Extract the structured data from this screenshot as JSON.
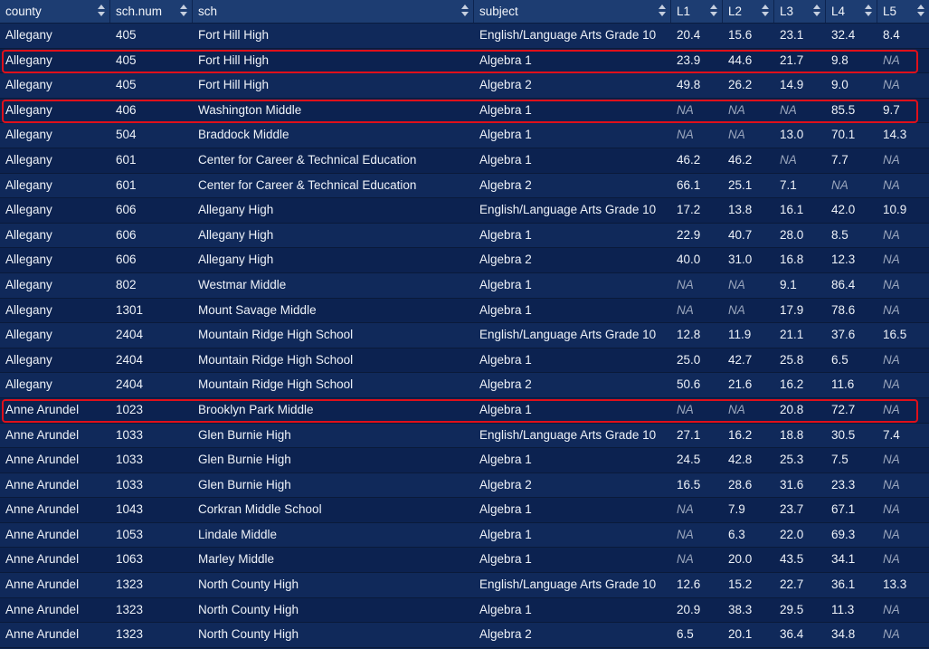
{
  "columns": [
    "county",
    "sch.num",
    "sch",
    "subject",
    "L1",
    "L2",
    "L3",
    "L4",
    "L5"
  ],
  "rows": [
    [
      "Allegany",
      "405",
      "Fort Hill High",
      "English/Language Arts Grade 10",
      "20.4",
      "15.6",
      "23.1",
      "32.4",
      "8.4"
    ],
    [
      "Allegany",
      "405",
      "Fort Hill High",
      "Algebra 1",
      "23.9",
      "44.6",
      "21.7",
      "9.8",
      "NA"
    ],
    [
      "Allegany",
      "405",
      "Fort Hill High",
      "Algebra 2",
      "49.8",
      "26.2",
      "14.9",
      "9.0",
      "NA"
    ],
    [
      "Allegany",
      "406",
      "Washington Middle",
      "Algebra 1",
      "NA",
      "NA",
      "NA",
      "85.5",
      "9.7"
    ],
    [
      "Allegany",
      "504",
      "Braddock Middle",
      "Algebra 1",
      "NA",
      "NA",
      "13.0",
      "70.1",
      "14.3"
    ],
    [
      "Allegany",
      "601",
      "Center for Career & Technical Education",
      "Algebra 1",
      "46.2",
      "46.2",
      "NA",
      "7.7",
      "NA"
    ],
    [
      "Allegany",
      "601",
      "Center for Career & Technical Education",
      "Algebra 2",
      "66.1",
      "25.1",
      "7.1",
      "NA",
      "NA"
    ],
    [
      "Allegany",
      "606",
      "Allegany High",
      "English/Language Arts Grade 10",
      "17.2",
      "13.8",
      "16.1",
      "42.0",
      "10.9"
    ],
    [
      "Allegany",
      "606",
      "Allegany High",
      "Algebra 1",
      "22.9",
      "40.7",
      "28.0",
      "8.5",
      "NA"
    ],
    [
      "Allegany",
      "606",
      "Allegany High",
      "Algebra 2",
      "40.0",
      "31.0",
      "16.8",
      "12.3",
      "NA"
    ],
    [
      "Allegany",
      "802",
      "Westmar Middle",
      "Algebra 1",
      "NA",
      "NA",
      "9.1",
      "86.4",
      "NA"
    ],
    [
      "Allegany",
      "1301",
      "Mount Savage Middle",
      "Algebra 1",
      "NA",
      "NA",
      "17.9",
      "78.6",
      "NA"
    ],
    [
      "Allegany",
      "2404",
      "Mountain Ridge High School",
      "English/Language Arts Grade 10",
      "12.8",
      "11.9",
      "21.1",
      "37.6",
      "16.5"
    ],
    [
      "Allegany",
      "2404",
      "Mountain Ridge High School",
      "Algebra 1",
      "25.0",
      "42.7",
      "25.8",
      "6.5",
      "NA"
    ],
    [
      "Allegany",
      "2404",
      "Mountain Ridge High School",
      "Algebra 2",
      "50.6",
      "21.6",
      "16.2",
      "11.6",
      "NA"
    ],
    [
      "Anne Arundel",
      "1023",
      "Brooklyn Park Middle",
      "Algebra 1",
      "NA",
      "NA",
      "20.8",
      "72.7",
      "NA"
    ],
    [
      "Anne Arundel",
      "1033",
      "Glen Burnie High",
      "English/Language Arts Grade 10",
      "27.1",
      "16.2",
      "18.8",
      "30.5",
      "7.4"
    ],
    [
      "Anne Arundel",
      "1033",
      "Glen Burnie High",
      "Algebra 1",
      "24.5",
      "42.8",
      "25.3",
      "7.5",
      "NA"
    ],
    [
      "Anne Arundel",
      "1033",
      "Glen Burnie High",
      "Algebra 2",
      "16.5",
      "28.6",
      "31.6",
      "23.3",
      "NA"
    ],
    [
      "Anne Arundel",
      "1043",
      "Corkran Middle School",
      "Algebra 1",
      "NA",
      "7.9",
      "23.7",
      "67.1",
      "NA"
    ],
    [
      "Anne Arundel",
      "1053",
      "Lindale Middle",
      "Algebra 1",
      "NA",
      "6.3",
      "22.0",
      "69.3",
      "NA"
    ],
    [
      "Anne Arundel",
      "1063",
      "Marley Middle",
      "Algebra 1",
      "NA",
      "20.0",
      "43.5",
      "34.1",
      "NA"
    ],
    [
      "Anne Arundel",
      "1323",
      "North County High",
      "English/Language Arts Grade 10",
      "12.6",
      "15.2",
      "22.7",
      "36.1",
      "13.3"
    ],
    [
      "Anne Arundel",
      "1323",
      "North County High",
      "Algebra 1",
      "20.9",
      "38.3",
      "29.5",
      "11.3",
      "NA"
    ],
    [
      "Anne Arundel",
      "1323",
      "North County High",
      "Algebra 2",
      "6.5",
      "20.1",
      "36.4",
      "34.8",
      "NA"
    ]
  ],
  "highlighted_rows": [
    1,
    3,
    15
  ],
  "colors": {
    "header_bg": "#1d3d72",
    "row_bg": "#10295a",
    "row_bg_alt": "#0c2250",
    "text": "#eef2f8",
    "na_text": "#9aa6bd",
    "highlight_border": "#e0101a"
  }
}
